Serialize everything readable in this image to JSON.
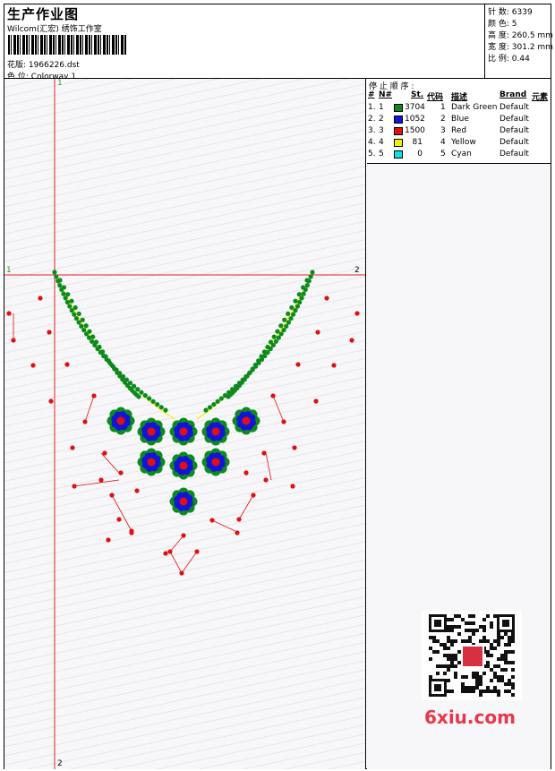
{
  "header": {
    "title": "生产作业图",
    "company": "Wilcom(汇宏) 绣饰工作室",
    "design_label": "花版:",
    "design_value": "1966226.dst",
    "colorway_label": "色 位:",
    "colorway_value": "Colorway 1"
  },
  "stats": [
    {
      "label": "针 数:",
      "value": "6339"
    },
    {
      "label": "颜 色:",
      "value": "5"
    },
    {
      "label": "高 度:",
      "value": "260.5 mm"
    },
    {
      "label": "宽 度:",
      "value": "301.2 mm"
    },
    {
      "label": "比 例:",
      "value": "0.44"
    }
  ],
  "legend": {
    "title": "停 止 顺 序 :",
    "columns": [
      "#",
      "N#",
      "St.",
      "代码",
      "描述",
      "Brand",
      "元素"
    ],
    "rows": [
      {
        "num": "1.",
        "n": "1",
        "stitches": "3704",
        "code": "1",
        "desc": "Dark Green",
        "brand": "Default",
        "color": "#0c8a1e"
      },
      {
        "num": "2.",
        "n": "2",
        "stitches": "1052",
        "code": "2",
        "desc": "Blue",
        "brand": "Default",
        "color": "#1414d8"
      },
      {
        "num": "3.",
        "n": "3",
        "stitches": "1500",
        "code": "3",
        "desc": "Red",
        "brand": "Default",
        "color": "#e01010"
      },
      {
        "num": "4.",
        "n": "4",
        "stitches": "81",
        "code": "4",
        "desc": "Yellow",
        "brand": "Default",
        "color": "#f2f200"
      },
      {
        "num": "5.",
        "n": "5",
        "stitches": "0",
        "code": "5",
        "desc": "Cyan",
        "brand": "Default",
        "color": "#10e0e0"
      }
    ]
  },
  "axes": {
    "v_top": "1",
    "v_bottom": "2",
    "h_left": "1",
    "h_right": "2"
  },
  "watermark": "6xiu.com",
  "colors": {
    "green": "#0c8a1e",
    "blue": "#1414d8",
    "red": "#e01010",
    "yellow": "#f2f200",
    "guide": "#e02020"
  }
}
